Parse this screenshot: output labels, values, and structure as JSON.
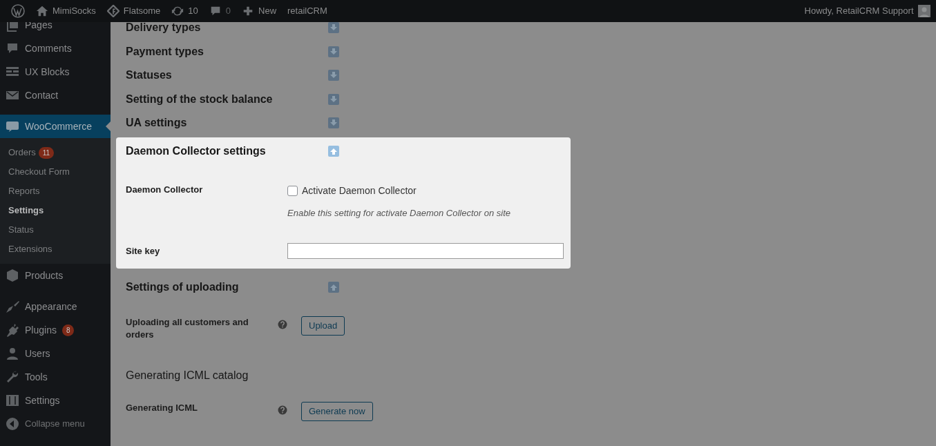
{
  "admin_bar": {
    "left": [
      {
        "kind": "wp"
      },
      {
        "kind": "home",
        "label": "MimiSocks"
      },
      {
        "kind": "theme",
        "label": "Flatsome"
      },
      {
        "kind": "updates",
        "label": "10"
      },
      {
        "kind": "comments",
        "label": "0"
      },
      {
        "kind": "new",
        "label": "New"
      },
      {
        "kind": "plain",
        "label": "retailCRM"
      }
    ],
    "greeting": "Howdy, RetailCRM Support"
  },
  "sidebar": {
    "items": [
      {
        "kind": "pages",
        "label": "Pages",
        "selected": false
      },
      {
        "kind": "comments",
        "label": "Comments",
        "selected": false
      },
      {
        "kind": "blocks",
        "label": "UX Blocks",
        "selected": false
      },
      {
        "kind": "mail",
        "label": "Contact",
        "selected": false,
        "separator_after": true
      },
      {
        "kind": "woo",
        "label": "WooCommerce",
        "selected": true,
        "children": [
          {
            "label": "Orders",
            "badge": "11",
            "selected": false
          },
          {
            "label": "Checkout Form",
            "selected": false
          },
          {
            "label": "Reports",
            "selected": false
          },
          {
            "label": "Settings",
            "selected": true
          },
          {
            "label": "Status",
            "selected": false
          },
          {
            "label": "Extensions",
            "selected": false
          }
        ]
      },
      {
        "kind": "box",
        "label": "Products",
        "selected": false,
        "separator_after": true
      },
      {
        "kind": "brush",
        "label": "Appearance",
        "selected": false
      },
      {
        "kind": "plug",
        "label": "Plugins",
        "badge": "8",
        "selected": false
      },
      {
        "kind": "user",
        "label": "Users",
        "selected": false
      },
      {
        "kind": "wrench",
        "label": "Tools",
        "selected": false
      },
      {
        "kind": "sliders",
        "label": "Settings",
        "selected": false
      },
      {
        "kind": "collapse",
        "label": "Collapse menu",
        "selected": false
      }
    ]
  },
  "sections": [
    {
      "title": "Delivery types",
      "expanded": false,
      "highlighted": false
    },
    {
      "title": "Payment types",
      "expanded": false,
      "highlighted": false
    },
    {
      "title": "Statuses",
      "expanded": false,
      "highlighted": false
    },
    {
      "title": "Setting of the stock balance",
      "expanded": false,
      "highlighted": false
    },
    {
      "title": "UA settings",
      "expanded": false,
      "highlighted": false
    },
    {
      "title": "Daemon Collector settings",
      "expanded": true,
      "highlighted": true,
      "rows": [
        {
          "kind": "checkbox",
          "label": "Daemon Collector",
          "option": "Activate Daemon Collector",
          "checked": false,
          "description": "Enable this setting for activate Daemon Collector on site"
        },
        {
          "kind": "text",
          "label": "Site key"
        }
      ]
    },
    {
      "title": "Settings of uploading",
      "expanded": true,
      "highlighted": false,
      "rows": [
        {
          "kind": "button",
          "label": "Uploading all customers and orders",
          "help": true,
          "button": "Upload"
        },
        {
          "kind": "subheading",
          "label": "Generating ICML catalog"
        },
        {
          "kind": "button",
          "label": "Generating ICML",
          "help": true,
          "button": "Generate now"
        }
      ]
    }
  ]
}
